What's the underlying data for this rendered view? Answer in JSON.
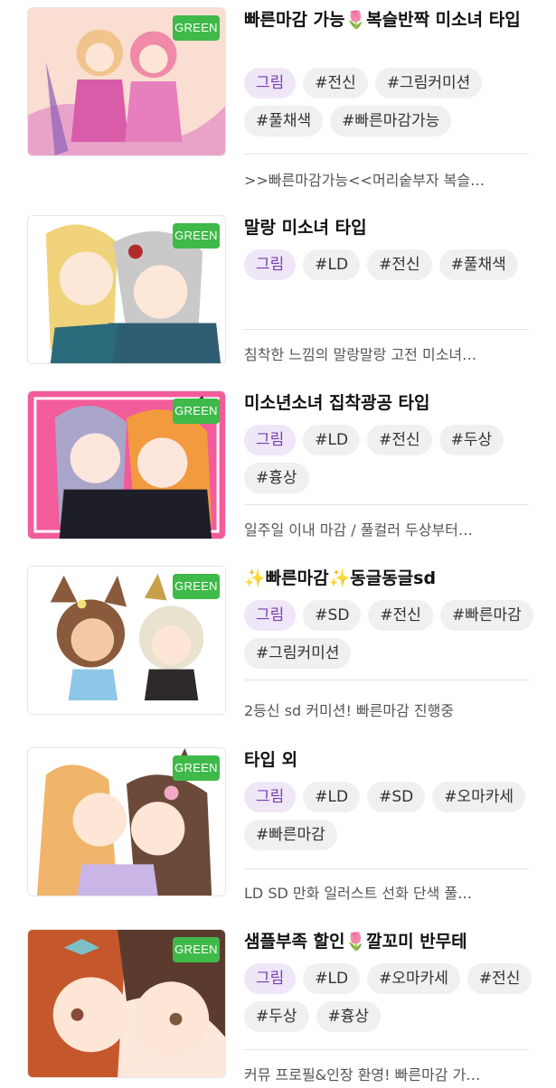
{
  "listings": [
    {
      "title": "빠른마감 가능🌷복슬반짝 미소녀 타입",
      "badge": "GREEN",
      "thumb_icon": "anime-illustration-two-girls-pink",
      "category": "그림",
      "tags": [
        "#전신",
        "#그림커미션",
        "#풀채색",
        "#빠른마감가능"
      ],
      "description": ">>빠른마감가능<<머리숱부자 복슬…",
      "palette": {
        "bg": "#f7d9e8",
        "hair1": "#f2c48d",
        "hair2": "#f08aa8",
        "cloth": "#d85ca8"
      }
    },
    {
      "title": "말랑 미소녀 타입",
      "badge": "GREEN",
      "thumb_icon": "anime-illustration-blonde-and-elf",
      "category": "그림",
      "tags": [
        "#LD",
        "#전신",
        "#풀채색"
      ],
      "description": "침착한 느낌의 말랑말랑 고전 미소녀…",
      "palette": {
        "bg": "#ffffff",
        "hair1": "#f0d27a",
        "hair2": "#c9c9c9",
        "cloth": "#2f5d73"
      }
    },
    {
      "title": "미소년소녀 집착광공 타입",
      "badge": "GREEN",
      "thumb_icon": "anime-illustration-pink-background-duo",
      "category": "그림",
      "tags": [
        "#LD",
        "#전신",
        "#두상",
        "#흉상"
      ],
      "description": "일주일 이내 마감 / 풀컬러 두상부터…",
      "palette": {
        "bg": "#f25c9a",
        "hair1": "#a9a6c9",
        "hair2": "#f29a3e",
        "cloth": "#1e1e28"
      }
    },
    {
      "title": "✨빠른마감✨동글동글sd",
      "badge": "GREEN",
      "thumb_icon": "chibi-illustration-horse-girls",
      "category": "그림",
      "tags": [
        "#SD",
        "#전신",
        "#빠른마감",
        "#그림커미션"
      ],
      "description": "2등신 sd 커미션! 빠른마감 진행중",
      "palette": {
        "bg": "#ffffff",
        "hair1": "#8a5a3c",
        "hair2": "#e8e2cf",
        "cloth": "#2e2a2a"
      }
    },
    {
      "title": "타입 외",
      "badge": "GREEN",
      "thumb_icon": "anime-illustration-two-horse-girls",
      "category": "그림",
      "tags": [
        "#LD",
        "#SD",
        "#오마카세",
        "#빠른마감"
      ],
      "description": "LD SD 만화 일러스트 선화 단색 풀…",
      "palette": {
        "bg": "#ffffff",
        "hair1": "#f0b56a",
        "hair2": "#6b4a3a",
        "cloth": "#c9b6e6"
      }
    },
    {
      "title": "샘플부족 할인🌷깔꼬미 반무테",
      "badge": "GREEN",
      "thumb_icon": "anime-illustration-closeup-faces",
      "category": "그림",
      "tags": [
        "#LD",
        "#오마카세",
        "#전신",
        "#두상",
        "#흉상"
      ],
      "description": "커뮤 프로필&인장 환영! 빠른마감 가…",
      "palette": {
        "bg": "#fde8dc",
        "hair1": "#c4572b",
        "hair2": "#5a3b2e",
        "cloth": "#f5d2c0"
      }
    }
  ]
}
